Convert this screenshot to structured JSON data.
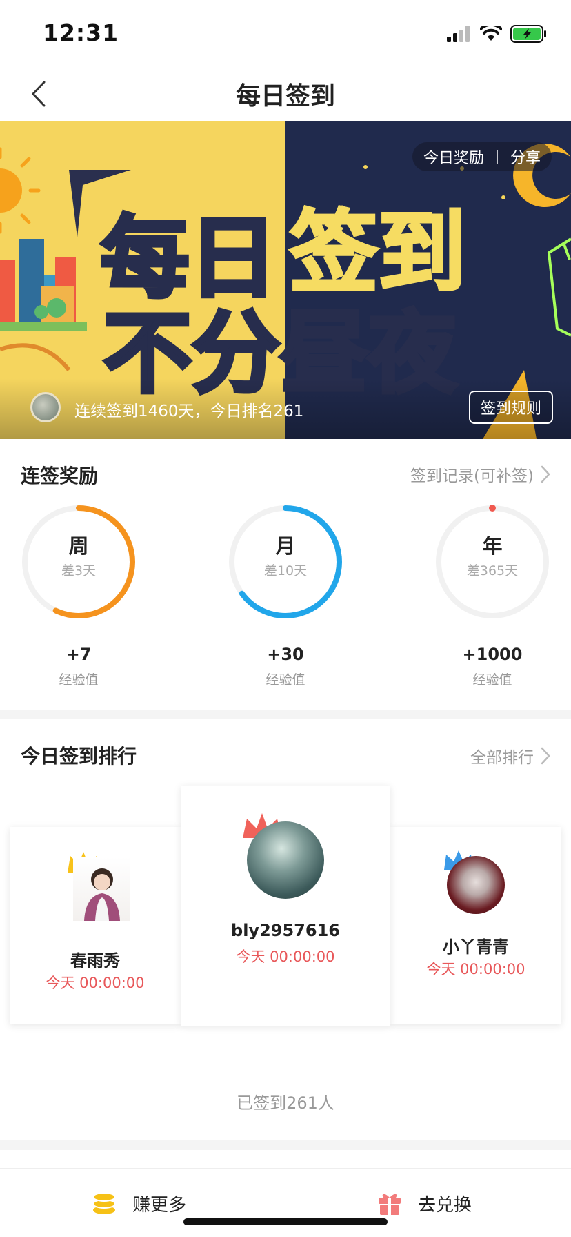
{
  "status_bar": {
    "time": "12:31"
  },
  "nav": {
    "title": "每日签到"
  },
  "banner": {
    "headline_line1": "每日签到",
    "headline_line2": "不分昼夜",
    "pill_reward": "今日奖励",
    "pill_share": "分享",
    "streak_text": "连续签到1460天，今日排名261",
    "rules_button": "签到规则"
  },
  "streak_rewards": {
    "title": "连签奖励",
    "link": "签到记录(可补签)",
    "items": [
      {
        "label": "周",
        "remaining": "差3天",
        "reward": "+7",
        "unit": "经验值",
        "progress": 0.57,
        "color": "#f5931e"
      },
      {
        "label": "月",
        "remaining": "差10天",
        "reward": "+30",
        "unit": "经验值",
        "progress": 0.65,
        "color": "#21a6ea"
      },
      {
        "label": "年",
        "remaining": "差365天",
        "reward": "+1000",
        "unit": "经验值",
        "progress": 0.0,
        "color": "#f0594f"
      }
    ]
  },
  "ranking": {
    "title": "今日签到排行",
    "link": "全部排行",
    "first": {
      "name": "bly2957616",
      "time": "今天 00:00:00",
      "crown_color": "#f0625a"
    },
    "second": {
      "name": "春雨秀",
      "time": "今天 00:00:00",
      "crown_color": "#f8c21a"
    },
    "third": {
      "name": "小丫青青",
      "time": "今天 00:00:00",
      "crown_color": "#3a9ae8"
    },
    "signed_count": "已签到261人"
  },
  "bottom_bar": {
    "earn_more": "赚更多",
    "exchange": "去兑换"
  },
  "colors": {
    "accent_red": "#e8585a",
    "banner_yellow": "#f5d55e",
    "banner_navy": "#202a4d"
  }
}
